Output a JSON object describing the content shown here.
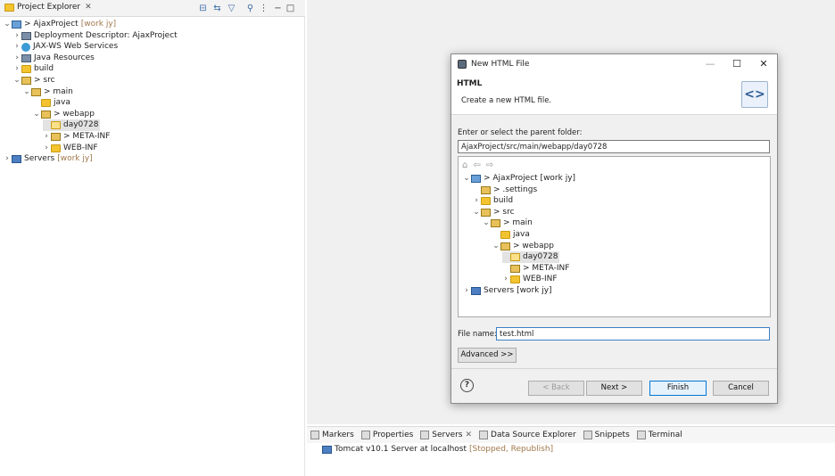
{
  "project_explorer": {
    "tab_title": "Project Explorer",
    "tree": [
      {
        "arrow": "v",
        "icon": "proj",
        "prefix": ">",
        "label": "AjaxProject",
        "suffix": "[work jy]"
      },
      {
        "arrow": ">",
        "icon": "descr",
        "prefix": "",
        "label": "Deployment Descriptor: AjaxProject",
        "suffix": ""
      },
      {
        "arrow": ">",
        "icon": "web",
        "prefix": "",
        "label": "JAX-WS Web Services",
        "suffix": ""
      },
      {
        "arrow": ">",
        "icon": "descr",
        "prefix": "",
        "label": "Java Resources",
        "suffix": ""
      },
      {
        "arrow": ">",
        "icon": "folder",
        "prefix": "",
        "label": "build",
        "suffix": ""
      },
      {
        "arrow": "v",
        "icon": "pkg",
        "prefix": ">",
        "label": "src",
        "suffix": ""
      },
      {
        "arrow": "v",
        "icon": "pkg",
        "prefix": ">",
        "label": "main",
        "suffix": ""
      },
      {
        "arrow": "",
        "icon": "folder",
        "prefix": "",
        "label": "java",
        "suffix": ""
      },
      {
        "arrow": "v",
        "icon": "pkg",
        "prefix": ">",
        "label": "webapp",
        "suffix": ""
      },
      {
        "arrow": "",
        "icon": "folder",
        "prefix": "",
        "label": "day0728",
        "suffix": ""
      },
      {
        "arrow": ">",
        "icon": "pkg",
        "prefix": ">",
        "label": "META-INF",
        "suffix": ""
      },
      {
        "arrow": ">",
        "icon": "folder",
        "prefix": "",
        "label": "WEB-INF",
        "suffix": ""
      },
      {
        "arrow": ">",
        "icon": "server",
        "prefix": "",
        "label": "Servers",
        "suffix": "[work jy]"
      }
    ]
  },
  "dialog": {
    "title": "New HTML File",
    "header_title": "HTML",
    "header_desc": "Create a new HTML file.",
    "header_icon_text": "<>",
    "parent_label": "Enter or select the parent folder:",
    "parent_value": "AjaxProject/src/main/webapp/day0728",
    "tree": [
      {
        "arrow": "v",
        "icon": "proj",
        "prefix": ">",
        "label": "AjaxProject [work jy]"
      },
      {
        "arrow": "",
        "icon": "pkg",
        "prefix": ">",
        "label": ".settings"
      },
      {
        "arrow": ">",
        "icon": "folder",
        "prefix": "",
        "label": "build"
      },
      {
        "arrow": "v",
        "icon": "pkg",
        "prefix": ">",
        "label": "src"
      },
      {
        "arrow": "v",
        "icon": "pkg",
        "prefix": ">",
        "label": "main"
      },
      {
        "arrow": "",
        "icon": "folder",
        "prefix": "",
        "label": "java"
      },
      {
        "arrow": "v",
        "icon": "pkg",
        "prefix": ">",
        "label": "webapp"
      },
      {
        "arrow": "",
        "icon": "folder",
        "prefix": "",
        "label": "day0728"
      },
      {
        "arrow": "",
        "icon": "pkg",
        "prefix": ">",
        "label": "META-INF"
      },
      {
        "arrow": ">",
        "icon": "folder",
        "prefix": "",
        "label": "WEB-INF"
      },
      {
        "arrow": ">",
        "icon": "server",
        "prefix": "",
        "label": "Servers [work jy]"
      }
    ],
    "file_label": "File name:",
    "file_value": "test.html",
    "advanced_label": "Advanced >>",
    "help_label": "?",
    "back_label": "< Back",
    "next_label": "Next >",
    "finish_label": "Finish",
    "cancel_label": "Cancel"
  },
  "bottom_panel": {
    "tabs": [
      "Markers",
      "Properties",
      "Servers",
      "Data Source Explorer",
      "Snippets",
      "Terminal"
    ],
    "server_entry": "Tomcat v10.1 Server at localhost",
    "server_status": "[Stopped, Republish]"
  }
}
